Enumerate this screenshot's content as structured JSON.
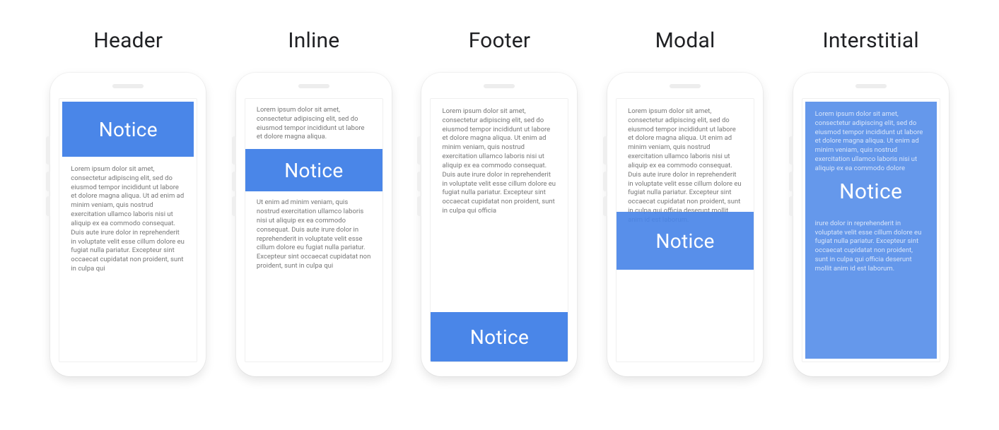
{
  "notice_label": "Notice",
  "examples": [
    {
      "title": "Header"
    },
    {
      "title": "Inline"
    },
    {
      "title": "Footer"
    },
    {
      "title": "Modal"
    },
    {
      "title": "Interstitial"
    }
  ],
  "lorem": {
    "short": "Lorem ipsum dolor sit amet, consectetur adipiscing elit, sed do eiusmod tempor incididunt ut labore et dolore magna aliqua.",
    "part2": "Ut enim ad minim veniam, quis nostrud exercitation ullamco laboris nisi ut aliquip ex ea commodo consequat. Duis aute irure dolor in reprehenderit in voluptate velit esse cillum dolore eu fugiat nulla pariatur. Excepteur sint occaecat cupidatat non proident, sunt in culpa qui",
    "header_body": "Lorem ipsum dolor sit amet, consectetur adipiscing elit, sed do eiusmod tempor incididunt ut labore et dolore magna aliqua. Ut ad enim ad minim veniam, quis nostrud exercitation ullamco laboris nisi ut aliquip ex ea commodo consequat. Duis aute irure dolor in reprehenderit in voluptate velit esse cillum dolore eu fugiat nulla pariatur. Excepteur sint occaecat cupidatat non proident, sunt in culpa qui",
    "footer_body": "Lorem ipsum dolor sit amet, consectetur adipiscing elit, sed do eiusmod tempor incididunt ut labore et dolore magna aliqua. Ut enim ad minim veniam, quis nostrud exercitation ullamco laboris nisi ut aliquip ex ea commodo consequat. Duis aute irure dolor in reprehenderit in voluptate velit esse cillum dolore eu fugiat nulla pariatur. Excepteur sint occaecat cupidatat non proident, sunt in culpa qui officia",
    "modal_body": "Lorem ipsum dolor sit amet, consectetur adipiscing elit, sed do eiusmod tempor incididunt ut labore et dolore magna aliqua. Ut enim ad minim veniam, quis nostrud exercitation ullamco laboris nisi ut aliquip ex ea commodo consequat. Duis aute irure dolor in reprehenderit in voluptate velit esse cillum dolore eu fugiat nulla pariatur. Excepteur sint occaecat cupidatat non proident, sunt in culpa qui officia deserunt mollit anim id est laborum.",
    "interstitial_top": "Lorem ipsum dolor sit amet, consectetur adipiscing elit, sed do eiusmod tempor incididunt ut labore et dolore magna aliqua. Ut enim ad minim veniam, quis nostrud exercitation ullamco laboris nisi ut aliquip ex ea commodo dolore",
    "interstitial_bottom": "irure dolor in reprehenderit in voluptate velit esse cillum dolore eu fugiat nulla pariatur. Excepteur sint occaecat cupidatat non proident, sunt in culpa qui officia deserunt mollit anim id est laborum."
  }
}
